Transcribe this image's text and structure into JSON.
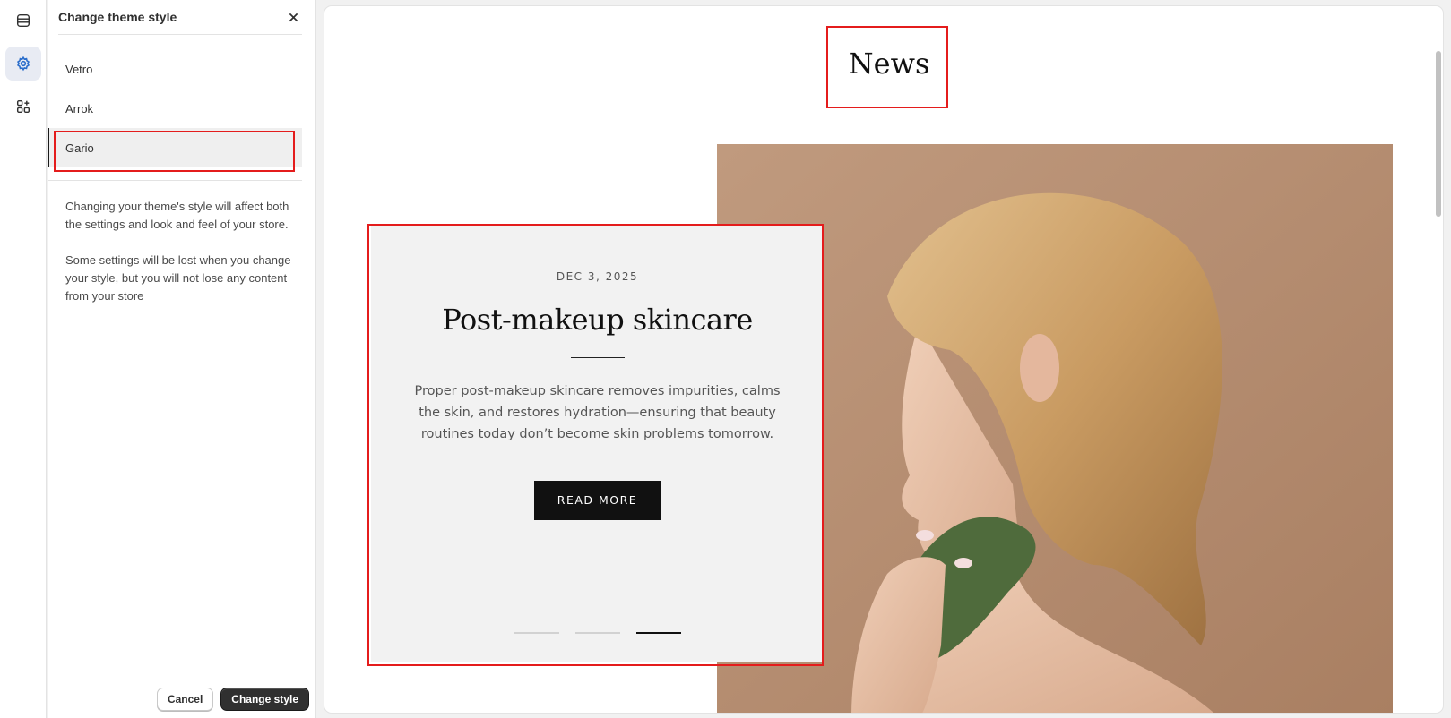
{
  "rail": {
    "items": [
      {
        "name": "sections",
        "icon": "sections-icon"
      },
      {
        "name": "settings",
        "icon": "gear-icon",
        "active": true
      },
      {
        "name": "apps",
        "icon": "apps-icon"
      }
    ]
  },
  "panel": {
    "title": "Change theme style",
    "close_icon": "close-icon",
    "styles": [
      {
        "label": "Vetro"
      },
      {
        "label": "Arrok"
      },
      {
        "label": "Gario",
        "selected": true
      }
    ],
    "help": [
      "Changing your theme's style will affect both the settings and look and feel of your store.",
      "Some settings will be lost when you change your style, but you will not lose any content from your store"
    ],
    "cancel_label": "Cancel",
    "submit_label": "Change style"
  },
  "preview": {
    "heading": "News",
    "article": {
      "date": "DEC 3, 2025",
      "title": "Post-makeup skincare",
      "excerpt": "Proper post-makeup skincare removes impurities, calms the skin, and restores hydration—ensuring that beauty routines today don’t become skin problems tomorrow.",
      "cta": "READ MORE"
    },
    "slides": {
      "count": 3,
      "active": 3
    }
  },
  "colors": {
    "highlight": "#e41c1c",
    "primary_button": "#303030",
    "rail_active": "#e8ebf3",
    "accent_icon": "#2c6ecb"
  }
}
